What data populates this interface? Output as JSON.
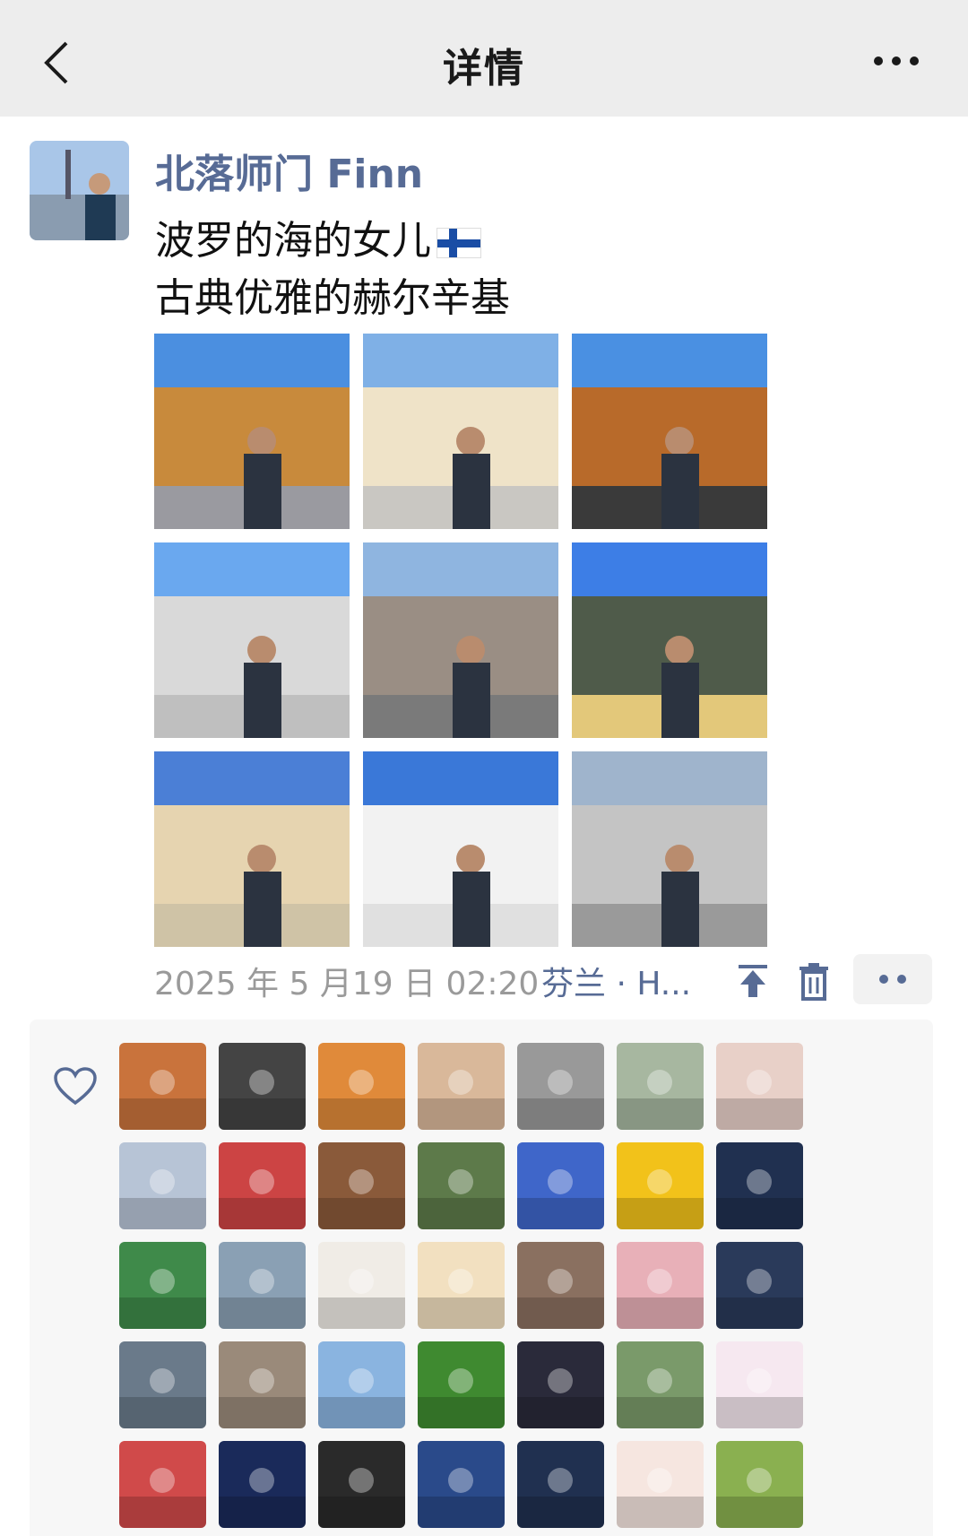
{
  "nav": {
    "title": "详情",
    "back_icon": "chevron-left-icon",
    "more_icon": "more-dots-icon"
  },
  "post": {
    "author": "北落师门 Finn",
    "line1": "波罗的海的女儿",
    "line2": "古典优雅的赫尔辛基",
    "flag_icon": "finland-flag-icon",
    "timestamp": "2025 年 5 月19 日 02:20",
    "location": "芬兰 · H...",
    "photos": [
      {
        "name": "photo-library-building"
      },
      {
        "name": "photo-white-building"
      },
      {
        "name": "photo-copper-chapel"
      },
      {
        "name": "photo-sitting-rooftop"
      },
      {
        "name": "photo-station-building"
      },
      {
        "name": "photo-statue-monument"
      },
      {
        "name": "photo-yellow-building"
      },
      {
        "name": "photo-cathedral"
      },
      {
        "name": "photo-pink-statue"
      }
    ]
  },
  "likes": {
    "heart_icon": "heart-outline-icon",
    "avatars": [
      "autumn-tree",
      "black-white-swirl",
      "sunset-road",
      "man-at-table",
      "cat-sticker",
      "field-road",
      "rainbow-face",
      "snow-mountain",
      "boy-microphone",
      "teddy-bear",
      "girl-trees",
      "pig-sticker",
      "sunflowers",
      "donald-duck",
      "green-mountains",
      "road-view",
      "woman-white",
      "cartoon-girl",
      "two-people-rocks",
      "girl-apple",
      "sky-silhouette",
      "man-beach",
      "alley",
      "sky-circle",
      "green-leaves",
      "girl-sunset",
      "runner",
      "pink-planet",
      "powerpuff",
      "starry-night",
      "woman-dark",
      "football-player",
      "tom-cat",
      "bear-sticker",
      "sunflower-field"
    ]
  },
  "colors": {
    "link": "#576b95",
    "nav_bg": "#ededed",
    "likes_bg": "#f7f7f7"
  }
}
